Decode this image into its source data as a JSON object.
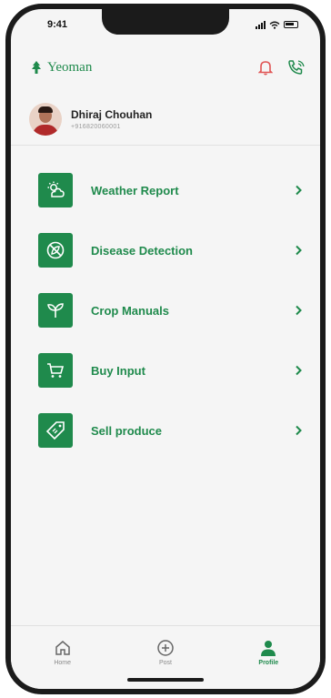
{
  "status_bar": {
    "time": "9:41"
  },
  "brand": {
    "name": "Yeoman"
  },
  "profile": {
    "name": "Dhiraj Chouhan",
    "phone": "+916820060001"
  },
  "menu": [
    {
      "label": "Weather Report",
      "icon": "weather-icon"
    },
    {
      "label": "Disease Detection",
      "icon": "disease-icon"
    },
    {
      "label": "Crop Manuals",
      "icon": "sprout-icon"
    },
    {
      "label": "Buy Input",
      "icon": "cart-icon"
    },
    {
      "label": "Sell produce",
      "icon": "tag-icon"
    }
  ],
  "bottom_nav": [
    {
      "label": "Home",
      "icon": "home-icon",
      "active": false
    },
    {
      "label": "Post",
      "icon": "plus-circle-icon",
      "active": false
    },
    {
      "label": "Profile",
      "icon": "person-icon",
      "active": true
    }
  ],
  "colors": {
    "accent": "#1f8a4c",
    "background": "#f5f5f5"
  }
}
